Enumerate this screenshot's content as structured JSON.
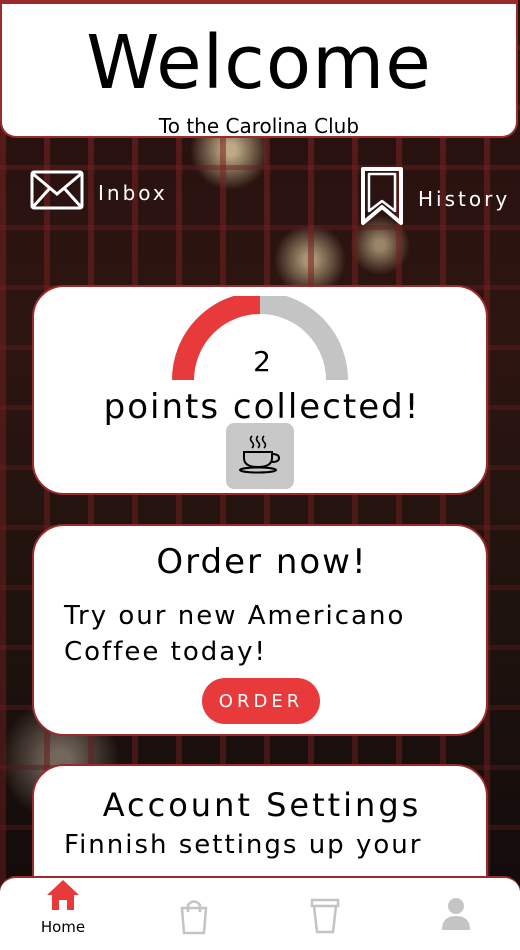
{
  "header": {
    "title": "Welcome",
    "subtitle": "To the Carolina Club"
  },
  "quick_links": {
    "inbox_label": "Inbox",
    "history_label": "History",
    "inbox_icon": "mail-icon",
    "history_icon": "bookmark-icon"
  },
  "points": {
    "count": "2",
    "label": "points collected!",
    "progress_fraction": 0.5,
    "progress_color": "#e83a3a",
    "track_color": "#c4c4c4",
    "reward_icon": "coffee-cup-icon"
  },
  "order_card": {
    "title": "Order now!",
    "body": "Try our new Americano Coffee today!",
    "button_label": "ORDER",
    "button_color": "#e83a3a"
  },
  "account_card": {
    "title": "Account Settings",
    "body": "Finnish settings up your"
  },
  "navbar": {
    "items": [
      {
        "label": "Home",
        "icon": "home-icon",
        "active": true
      },
      {
        "label": "",
        "icon": "shopping-bag-icon",
        "active": false
      },
      {
        "label": "",
        "icon": "coffee-cup-icon",
        "active": false
      },
      {
        "label": "",
        "icon": "user-icon",
        "active": false
      }
    ],
    "active_color": "#e83a3a",
    "inactive_color": "#c4c4c4"
  },
  "colors": {
    "accent": "#e83a3a",
    "border": "#9b2b2b"
  }
}
